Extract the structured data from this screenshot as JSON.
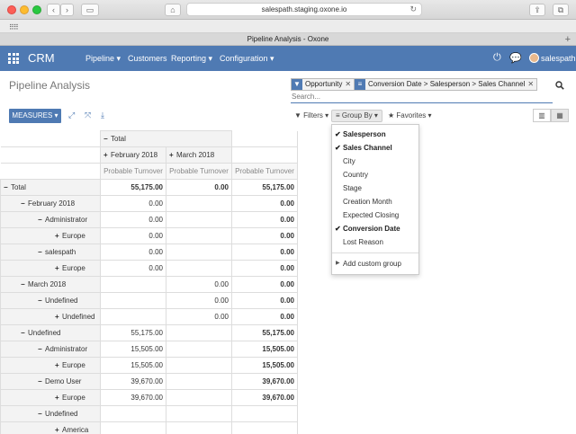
{
  "browser": {
    "url": "salespath.staging.oxone.io",
    "tab_title": "Pipeline Analysis - Oxone"
  },
  "nav": {
    "brand": "CRM",
    "menus": [
      {
        "label": "Pipeline ▾"
      },
      {
        "label": "Customers"
      },
      {
        "label": "Reporting ▾"
      },
      {
        "label": "Configuration ▾"
      }
    ],
    "username": "salespath"
  },
  "control": {
    "title": "Pipeline Analysis",
    "facets": [
      {
        "icon": "filter-icon",
        "label": "Opportunity"
      },
      {
        "icon": "group-icon",
        "label": "Conversion Date > Salesperson > Sales Channel"
      }
    ],
    "search_placeholder": "Search...",
    "measures_label": "MEASURES ▾",
    "filters_label": "Filters ▾",
    "groupby_label": "Group By ▾",
    "favorites_label": "Favorites ▾"
  },
  "pivot": {
    "col_total": "Total",
    "col_groups": [
      "February 2018",
      "March 2018"
    ],
    "measure": "Probable Turnover",
    "rows": [
      {
        "sym": "−",
        "label": "Total",
        "indent": 0,
        "v1": "55,175.00",
        "v2": "0.00",
        "v3": "55,175.00",
        "b1": true,
        "b2": true
      },
      {
        "sym": "−",
        "label": "February 2018",
        "indent": 1,
        "v1": "0.00",
        "v2": "",
        "v3": "0.00"
      },
      {
        "sym": "−",
        "label": "Administrator",
        "indent": 2,
        "v1": "0.00",
        "v2": "",
        "v3": "0.00"
      },
      {
        "sym": "+",
        "label": "Europe",
        "indent": 3,
        "v1": "0.00",
        "v2": "",
        "v3": "0.00"
      },
      {
        "sym": "−",
        "label": "salespath",
        "indent": 2,
        "v1": "0.00",
        "v2": "",
        "v3": "0.00"
      },
      {
        "sym": "+",
        "label": "Europe",
        "indent": 3,
        "v1": "0.00",
        "v2": "",
        "v3": "0.00"
      },
      {
        "sym": "−",
        "label": "March 2018",
        "indent": 1,
        "v1": "",
        "v2": "0.00",
        "v3": "0.00"
      },
      {
        "sym": "−",
        "label": "Undefined",
        "indent": 2,
        "v1": "",
        "v2": "0.00",
        "v3": "0.00"
      },
      {
        "sym": "+",
        "label": "Undefined",
        "indent": 3,
        "v1": "",
        "v2": "0.00",
        "v3": "0.00"
      },
      {
        "sym": "−",
        "label": "Undefined",
        "indent": 1,
        "v1": "55,175.00",
        "v2": "",
        "v3": "55,175.00"
      },
      {
        "sym": "−",
        "label": "Administrator",
        "indent": 2,
        "v1": "15,505.00",
        "v2": "",
        "v3": "15,505.00"
      },
      {
        "sym": "+",
        "label": "Europe",
        "indent": 3,
        "v1": "15,505.00",
        "v2": "",
        "v3": "15,505.00"
      },
      {
        "sym": "−",
        "label": "Demo User",
        "indent": 2,
        "v1": "39,670.00",
        "v2": "",
        "v3": "39,670.00"
      },
      {
        "sym": "+",
        "label": "Europe",
        "indent": 3,
        "v1": "39,670.00",
        "v2": "",
        "v3": "39,670.00"
      },
      {
        "sym": "−",
        "label": "Undefined",
        "indent": 2,
        "v1": "",
        "v2": "",
        "v3": ""
      },
      {
        "sym": "+",
        "label": "America",
        "indent": 3,
        "v1": "",
        "v2": "",
        "v3": ""
      }
    ]
  },
  "groupby_menu": {
    "items": [
      {
        "label": "Salesperson",
        "selected": true
      },
      {
        "label": "Sales Channel",
        "selected": true
      },
      {
        "label": "City",
        "selected": false
      },
      {
        "label": "Country",
        "selected": false
      },
      {
        "label": "Stage",
        "selected": false
      },
      {
        "label": "Creation Month",
        "selected": false
      },
      {
        "label": "Expected Closing",
        "selected": false
      },
      {
        "label": "Conversion Date",
        "selected": true
      },
      {
        "label": "Lost Reason",
        "selected": false
      }
    ],
    "add_custom": "Add custom group"
  },
  "colors": {
    "primary": "#4f7ab3",
    "accent_link": "#4f7ab3"
  }
}
